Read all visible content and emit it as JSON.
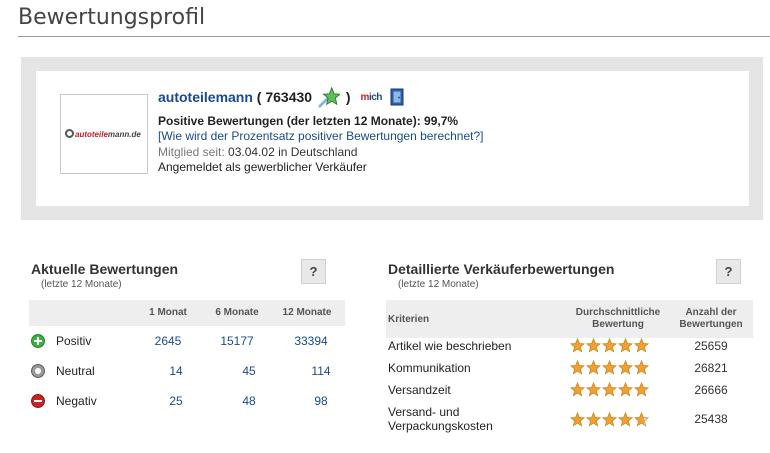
{
  "page": {
    "title": "Bewertungsprofil"
  },
  "profile": {
    "logo_text_red": "auto",
    "logo_text_mid": "teile",
    "logo_text_dark": "mann.de",
    "seller_name": "autoteilemann",
    "score_open": " ( 763430 ",
    "score_close": " )",
    "mich_text_m": "m",
    "mich_text_rest": "ich",
    "positive_text": "Positive Bewertungen (der letzten 12 Monate): 99,7%",
    "how_link": "[Wie wird der Prozentsatz positiver Bewertungen berechnet?]",
    "member_label": "Mitglied seit: ",
    "member_value": "03.04.02 in Deutschland",
    "registered": "Angemeldet als gewerblicher Verkäufer",
    "colors": {
      "link": "#1a4a8c",
      "star_green": "#3cb043"
    }
  },
  "current": {
    "title": "Aktuelle Bewertungen",
    "subtitle": "(letzte 12 Monate)",
    "help": "?",
    "columns": [
      "1 Monat",
      "6 Monate",
      "12 Monate"
    ],
    "rows": [
      {
        "icon": "positive-icon",
        "label": "Positiv",
        "values": [
          "2645",
          "15177",
          "33394"
        ],
        "color": "#3cb043"
      },
      {
        "icon": "neutral-icon",
        "label": "Neutral",
        "values": [
          "14",
          "45",
          "114"
        ],
        "color": "#888888"
      },
      {
        "icon": "negative-icon",
        "label": "Negativ",
        "values": [
          "25",
          "48",
          "98"
        ],
        "color": "#cc2222"
      }
    ]
  },
  "detailed": {
    "title": "Detaillierte Verkäuferbewertungen",
    "subtitle": "(letzte 12 Monate)",
    "help": "?",
    "col_criteria": "Kriterien",
    "col_avg": "Durchschnittliche Bewertung",
    "col_count": "Anzahl der Bewertungen",
    "rows": [
      {
        "label": "Artikel wie beschrieben",
        "stars": 5,
        "count": "25659"
      },
      {
        "label": "Kommunikation",
        "stars": 5,
        "count": "26821"
      },
      {
        "label": "Versandzeit",
        "stars": 5,
        "count": "26666"
      },
      {
        "label": "Versand- und Verpackungskosten",
        "stars": 4.7,
        "count": "25438"
      }
    ],
    "star_color": "#f0a030"
  }
}
